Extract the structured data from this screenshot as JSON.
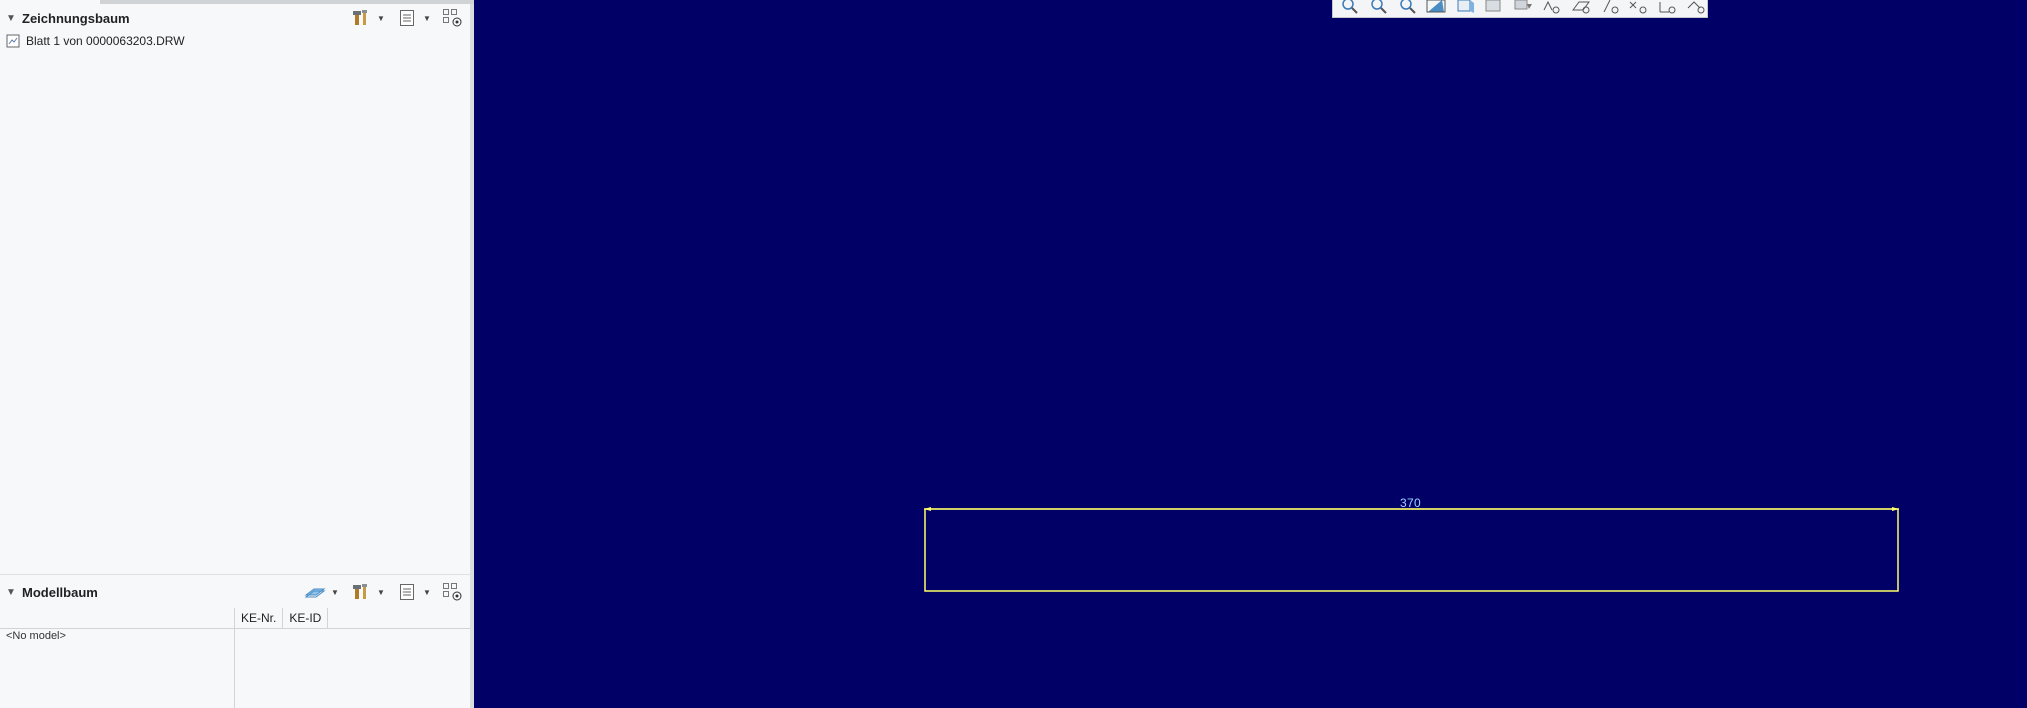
{
  "drawing_tree": {
    "title": "Zeichnungsbaum",
    "items": [
      {
        "label": "Blatt 1 von 0000063203.DRW",
        "icon": "sheet-icon"
      }
    ],
    "tools": [
      "settings-hammer-icon",
      "show-list-icon",
      "filter-icon"
    ]
  },
  "model_tree": {
    "title": "Modellbaum",
    "columns": [
      "KE-Nr.",
      "KE-ID"
    ],
    "empty_text": "<No model>",
    "tools": [
      "layer-icon",
      "settings-hammer-icon",
      "show-list-icon",
      "filter-icon"
    ]
  },
  "canvas": {
    "background": "#000066",
    "dimension_value": "370",
    "line_color": "#ffff66",
    "dimension_color": "#9fd3ff"
  },
  "view_toolbar": {
    "icons": [
      "refit-icon",
      "zoom-in-icon",
      "zoom-out-icon",
      "repaint-icon",
      "display-style-icon",
      "view-manager-icon",
      "orient-icon",
      "datum-display-icon",
      "plane-display-icon",
      "axis-display-icon",
      "point-display-icon",
      "csys-display-icon",
      "annotation-display-icon"
    ]
  }
}
